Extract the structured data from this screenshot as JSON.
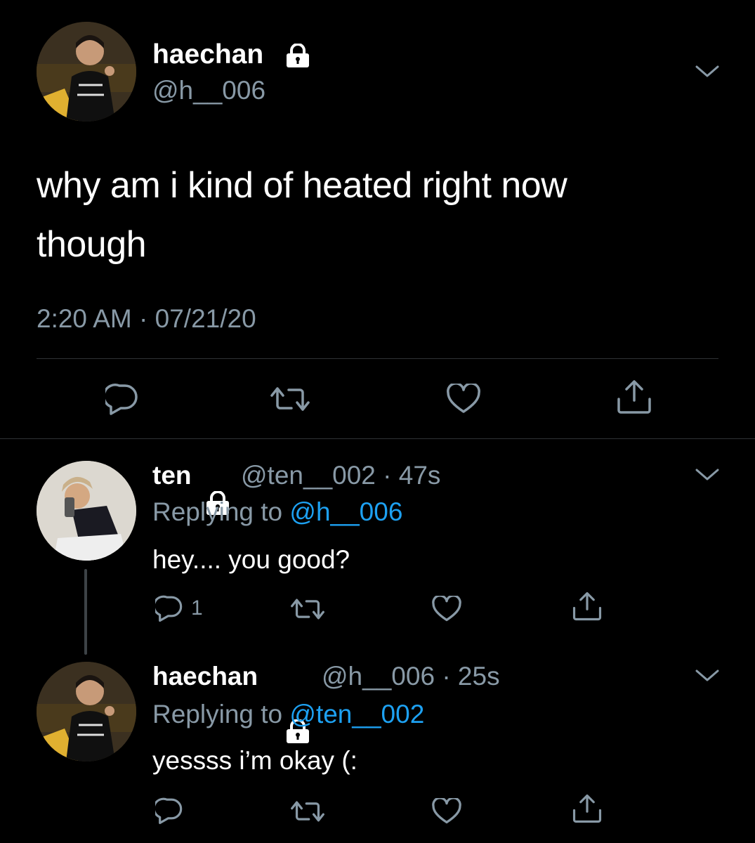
{
  "main_tweet": {
    "display_name": "haechan",
    "handle": "@h__006",
    "text_line1": "why am i kind of heated right now",
    "text_line2": "though",
    "timestamp": "2:20 AM · 07/21/20"
  },
  "replies": [
    {
      "display_name": "ten",
      "handle": "@ten__002",
      "time": "· 47s",
      "replying_prefix": "Replying to ",
      "replying_to": "@h__006",
      "text": "hey.... you good?",
      "reply_count": "1"
    },
    {
      "display_name": "haechan",
      "handle": "@h__006",
      "time": "· 25s",
      "replying_prefix": "Replying to ",
      "replying_to": "@ten__002",
      "text": "yessss i’m okay (:",
      "reply_count": ""
    }
  ],
  "icons": [
    "lock-icon",
    "chevron-down-icon",
    "reply-icon",
    "retweet-icon",
    "like-icon",
    "share-icon"
  ],
  "colors": {
    "background": "#000000",
    "muted": "#8899a6",
    "link": "#1da1f2",
    "divider": "#2f3336"
  }
}
